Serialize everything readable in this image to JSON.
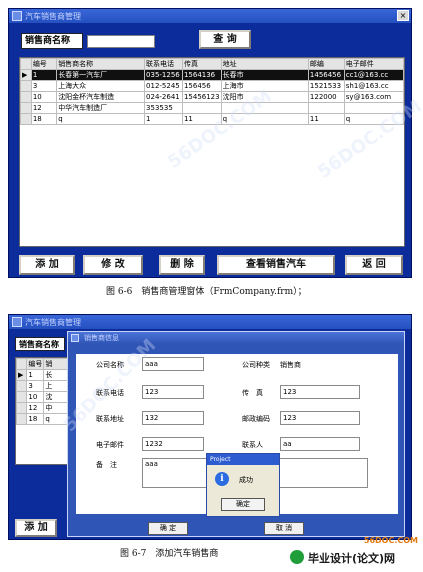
{
  "window1": {
    "title": "汽车销售商管理",
    "close": "×",
    "search_label": "销售商名称",
    "search_value": "",
    "query_button": "查 询",
    "grid": {
      "columns": [
        "编号",
        "销售商名称",
        "联系电话",
        "传真",
        "地址",
        "邮编",
        "电子邮件"
      ],
      "rows": [
        [
          "1",
          "长春第一汽车厂",
          "035-1256",
          "1564136",
          "长春市",
          "1456456",
          "cc1@163.cc"
        ],
        [
          "3",
          "上海大众",
          "012-5245",
          "156456",
          "上海市",
          "1521533",
          "sh1@163.cc"
        ],
        [
          "10",
          "沈阳金杯汽车制造",
          "024-2641",
          "15456123",
          "沈阳市",
          "122000",
          "sy@163.com"
        ],
        [
          "12",
          "中华汽车制造厂",
          "353535",
          "",
          "",
          "",
          ""
        ],
        [
          "18",
          "q",
          "1",
          "11",
          "q",
          "11",
          "q"
        ]
      ]
    },
    "buttons": {
      "add": "添 加",
      "edit": "修 改",
      "delete": "删 除",
      "view": "查看销售汽车",
      "back": "返 回"
    }
  },
  "caption1": "图 6-6　销售商管理窗体（FrmCompany.frm）；",
  "window2": {
    "title": "汽车销售商管理",
    "search_label": "销售商名称",
    "grid_columns": [
      "编号",
      "销"
    ],
    "grid_rows": [
      [
        "1",
        "长"
      ],
      [
        "3",
        "上"
      ],
      [
        "10",
        "沈"
      ],
      [
        "12",
        "中"
      ],
      [
        "18",
        "q"
      ]
    ],
    "add_button": "添 加",
    "dialog": {
      "title": "销售商信息",
      "fields": {
        "company_name_label": "公司名称",
        "company_name": "aaa",
        "company_type_label": "公司种类",
        "company_type": "销售商",
        "phone_label": "联系电话",
        "phone": "123",
        "fax_label": "传　真",
        "fax": "123",
        "address_label": "联系地址",
        "address": "132",
        "zip_label": "邮政编码",
        "zip": "123",
        "email_label": "电子邮件",
        "email": "1232",
        "contact_label": "联系人",
        "contact": "aa",
        "notes_label": "备　注",
        "notes": "aaa"
      },
      "ok_button": "确 定",
      "cancel_button": "取 消"
    },
    "message": {
      "title": "Project",
      "text": "成功",
      "ok": "确定",
      "icon": "info-icon"
    }
  },
  "caption2": "图 6-7　添加汽车销售商",
  "watermarks": [
    "56DOC.COM",
    "56DOC.COM",
    "56DOC.COM"
  ],
  "site_logo": {
    "domain": "56DOC.COM",
    "name": "毕业设计(论文)网"
  },
  "colors": {
    "window_blue": "#0c2c9c",
    "title_blue": "#2450c0",
    "logo_orange": "#e07a10"
  }
}
